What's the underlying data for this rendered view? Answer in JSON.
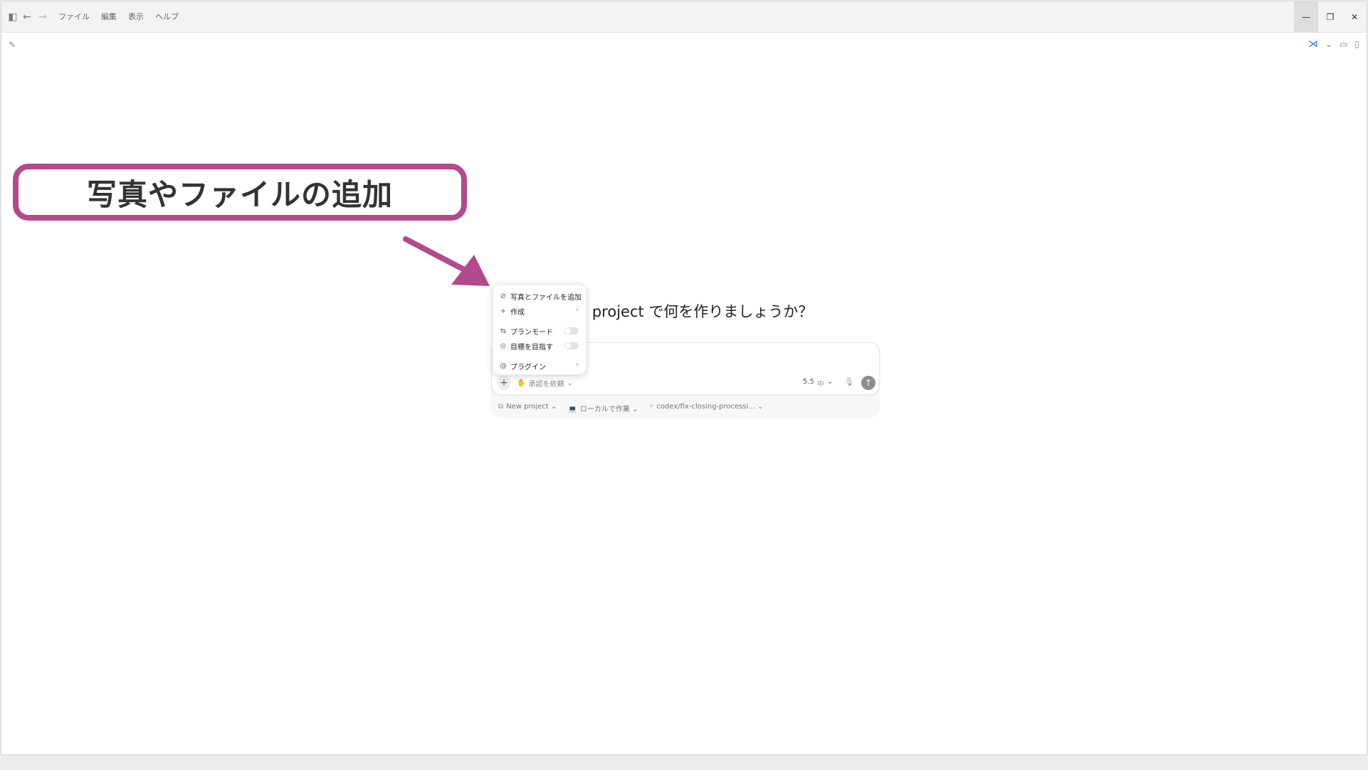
{
  "titlebar": {
    "menu": [
      "ファイル",
      "編集",
      "表示",
      "ヘルプ"
    ]
  },
  "main": {
    "heading": "w project で何を作りましょうか？"
  },
  "popup": {
    "items": [
      {
        "label": "写真とファイルを追加",
        "icon": "paperclip-icon"
      },
      {
        "label": "作成",
        "icon": "plus-icon"
      },
      {
        "label": "プランモード",
        "icon": "plan-icon"
      },
      {
        "label": "目標を目指す",
        "icon": "target-icon"
      },
      {
        "label": "プラグイン",
        "icon": "at-icon"
      }
    ]
  },
  "composer": {
    "approval": "承認を依頼",
    "model": "5.5",
    "effort": "中"
  },
  "footer": {
    "project": "New project",
    "location": "ローカルで作業",
    "branch": "codex/fix-closing-processi..."
  },
  "annotation": {
    "text": "写真やファイルの追加",
    "color": "#b24a8c"
  }
}
